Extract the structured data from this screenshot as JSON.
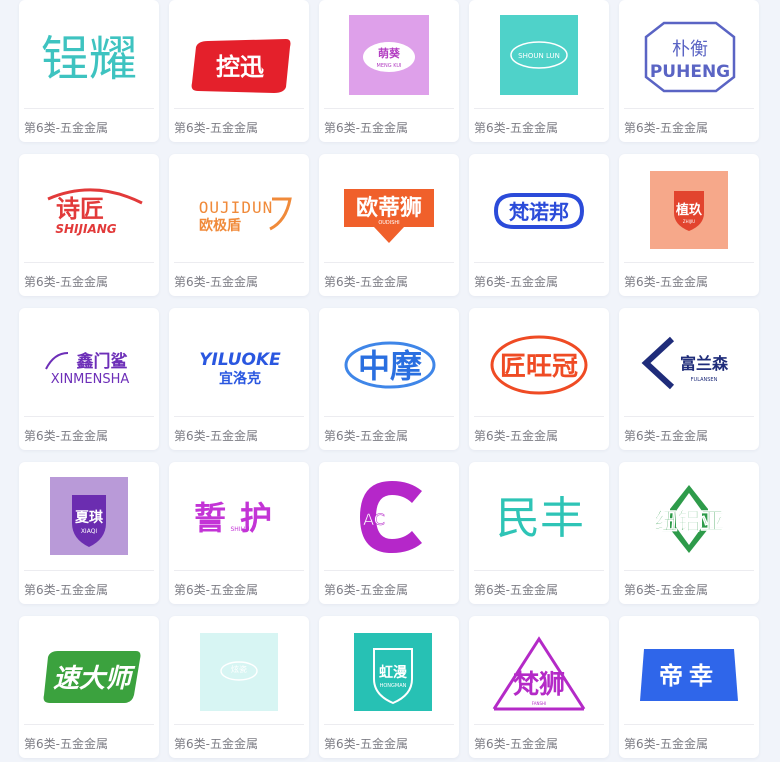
{
  "trademark_grid": {
    "items": [
      {
        "logo_name": "锃耀",
        "category": "第6类-五金金属"
      },
      {
        "logo_name": "控迅",
        "category": "第6类-五金金属"
      },
      {
        "logo_name": "萌葵",
        "logo_sub": "MENG KUI",
        "category": "第6类-五金金属"
      },
      {
        "logo_name": "SHOUN LUN",
        "category": "第6类-五金金属"
      },
      {
        "logo_name": "朴衡",
        "logo_sub": "PUHENG",
        "category": "第6类-五金金属"
      },
      {
        "logo_name": "诗匠",
        "logo_sub": "SHIJIANG",
        "category": "第6类-五金金属"
      },
      {
        "logo_name": "OUJIDUN",
        "logo_sub": "欧极盾",
        "category": "第6类-五金金属"
      },
      {
        "logo_name": "欧蒂狮",
        "logo_sub": "OUDISHI",
        "category": "第6类-五金金属"
      },
      {
        "logo_name": "梵诺邦",
        "category": "第6类-五金金属"
      },
      {
        "logo_name": "植玖",
        "logo_sub": "ZHIJIU",
        "category": "第6类-五金金属"
      },
      {
        "logo_name": "鑫门鲨",
        "logo_sub": "XINMENSHA",
        "category": "第6类-五金金属"
      },
      {
        "logo_name": "YILUOKE",
        "logo_sub": "宜洛克",
        "category": "第6类-五金金属"
      },
      {
        "logo_name": "中摩",
        "category": "第6类-五金金属"
      },
      {
        "logo_name": "匠旺冠",
        "category": "第6类-五金金属"
      },
      {
        "logo_name": "富兰森",
        "logo_sub": "FULANSEN",
        "category": "第6类-五金金属"
      },
      {
        "logo_name": "夏琪",
        "logo_sub": "XIAQI",
        "category": "第6类-五金金属"
      },
      {
        "logo_name": "誓护",
        "logo_sub": "SHIHU",
        "category": "第6类-五金金属"
      },
      {
        "logo_name": "AC",
        "category": "第6类-五金金属"
      },
      {
        "logo_name": "民丰",
        "category": "第6类-五金金属"
      },
      {
        "logo_name": "纽铝亚",
        "category": "第6类-五金金属"
      },
      {
        "logo_name": "速大师",
        "category": "第6类-五金金属"
      },
      {
        "logo_name": "炫瓷",
        "category": "第6类-五金金属"
      },
      {
        "logo_name": "虹漫",
        "logo_sub": "HONGMAN",
        "category": "第6类-五金金属"
      },
      {
        "logo_name": "梵狮",
        "logo_sub": "FANSHI",
        "category": "第6类-五金金属"
      },
      {
        "logo_name": "帝幸",
        "category": "第6类-五金金属"
      }
    ]
  },
  "colors": {
    "page_bg": "#f1f4fa",
    "card_bg": "#ffffff",
    "caption": "#7d7d85"
  }
}
